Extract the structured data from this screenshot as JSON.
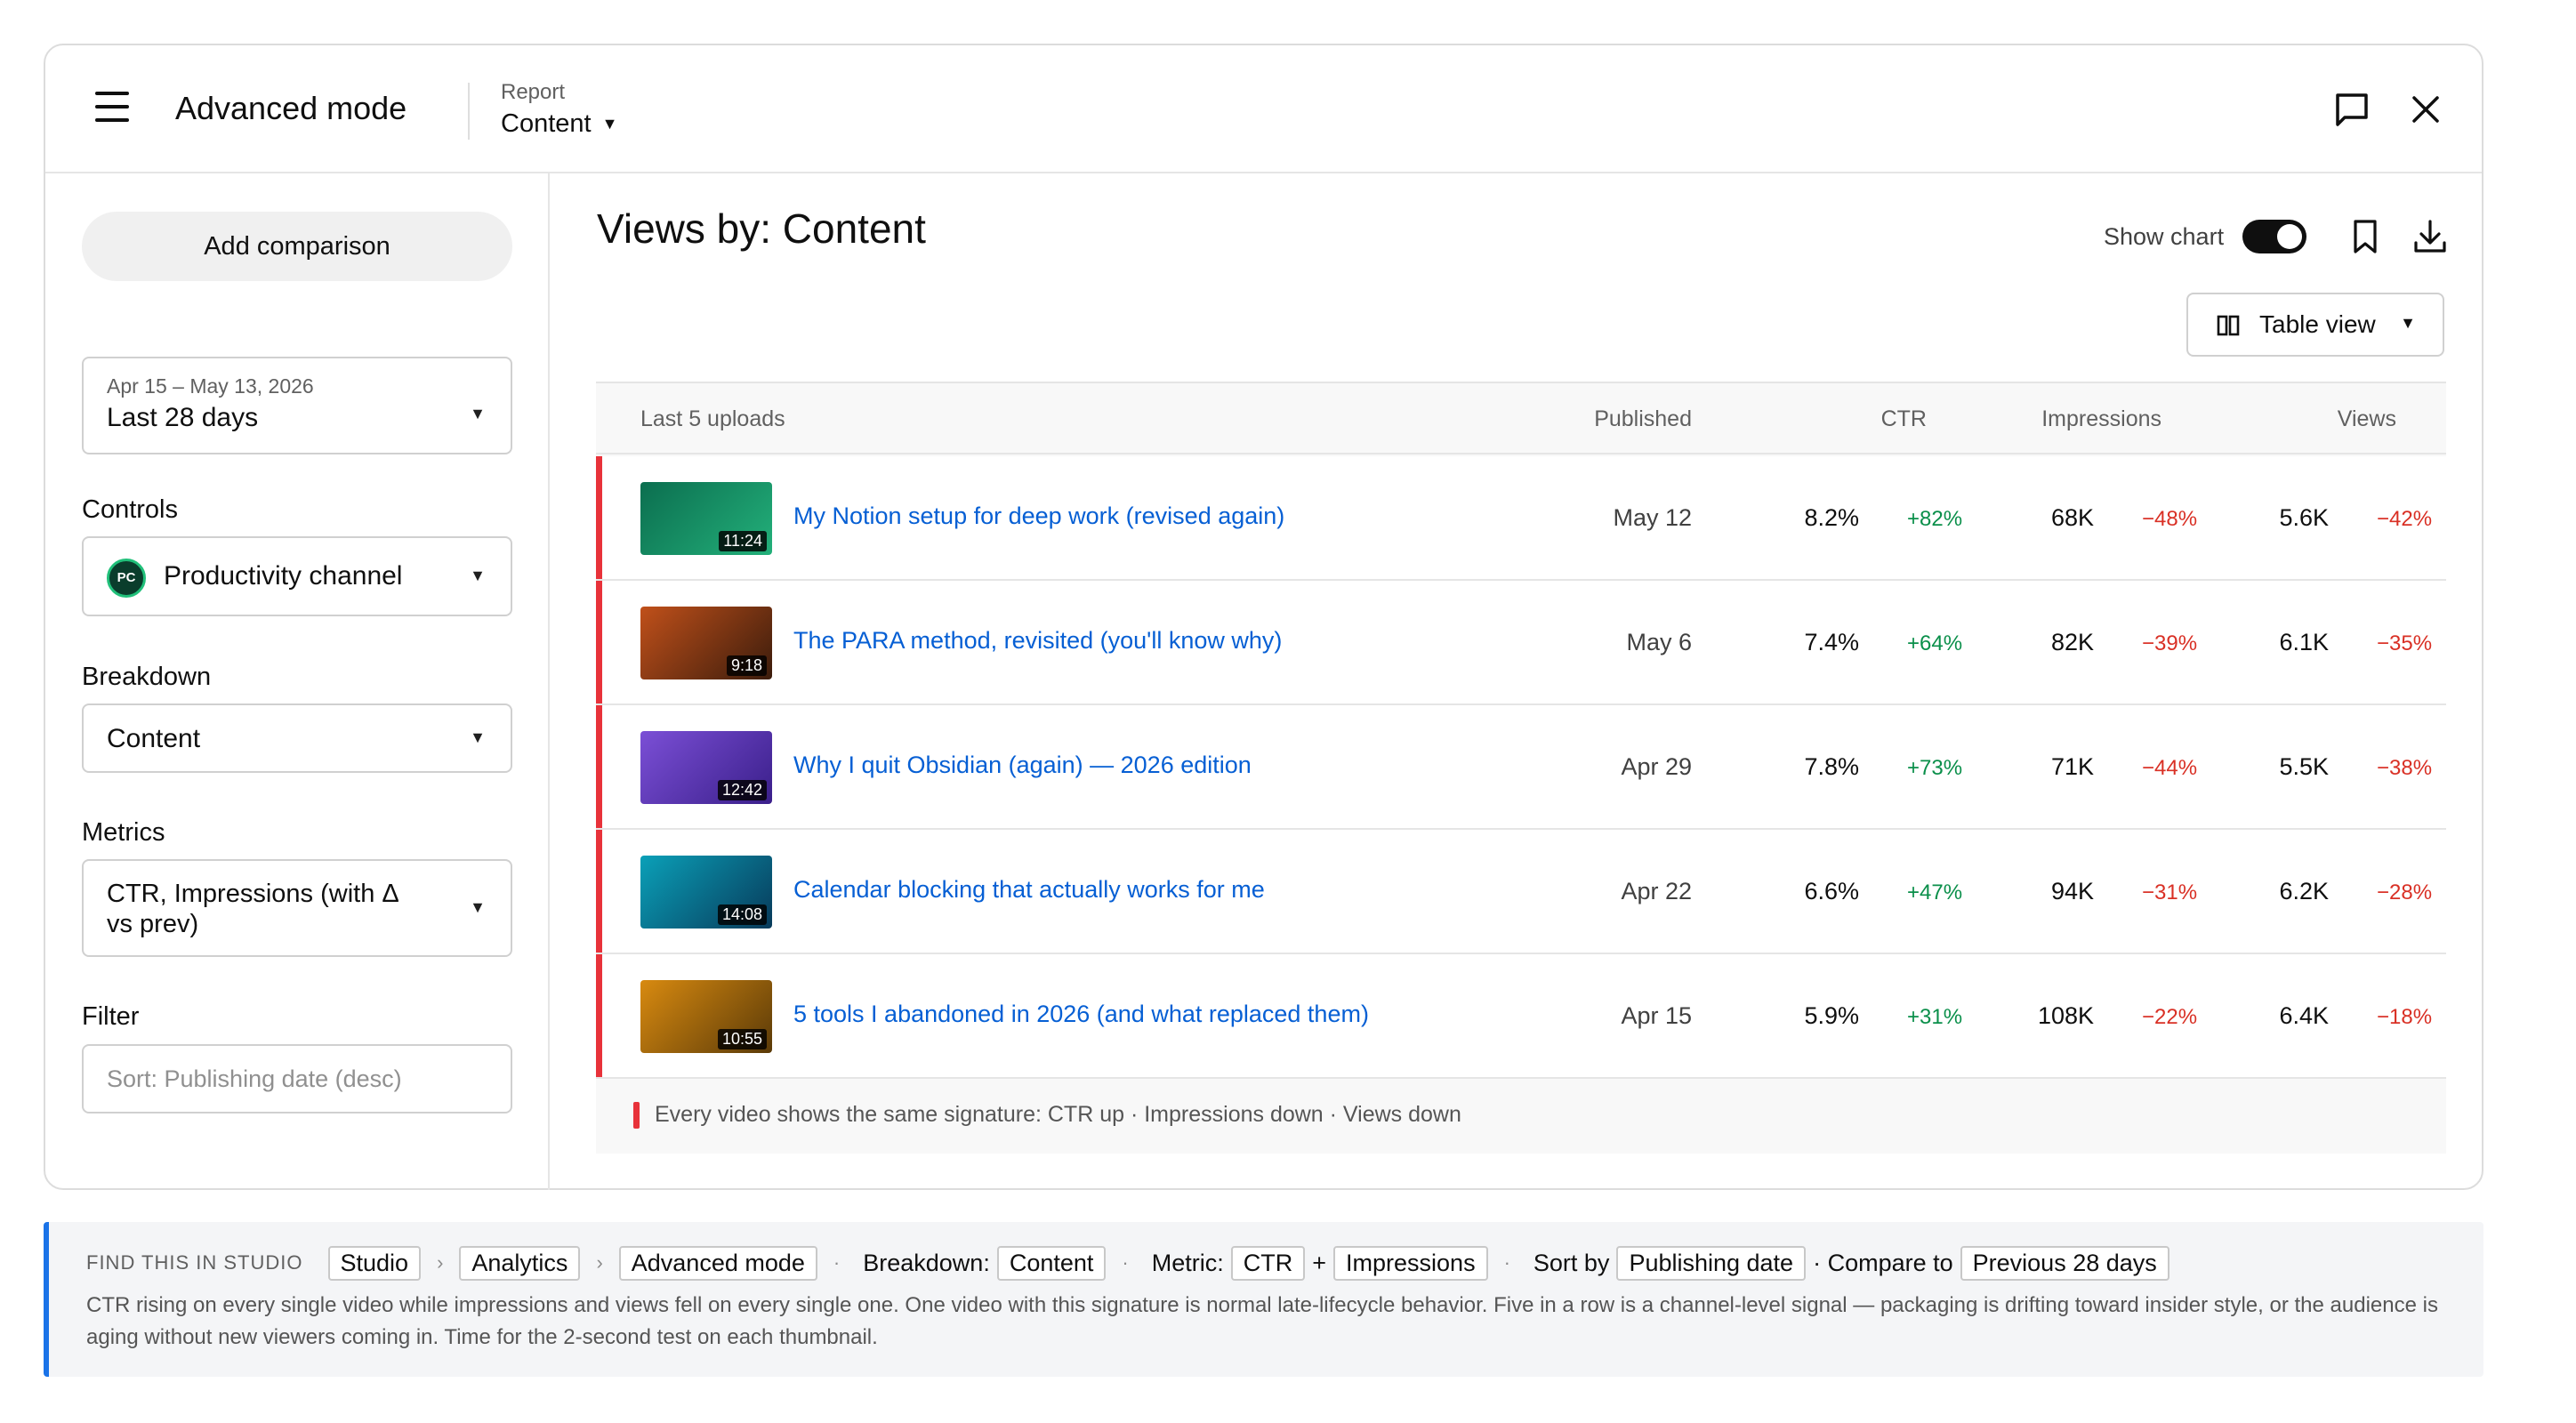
{
  "header": {
    "mode_title": "Advanced mode",
    "report_label": "Report",
    "report_value": "Content"
  },
  "sidebar": {
    "add_comparison": "Add comparison",
    "date_range": {
      "sub": "Apr 15 – May 13, 2026",
      "value": "Last 28 days"
    },
    "controls_label": "Controls",
    "channel": {
      "avatar": "PC",
      "name": "Productivity channel"
    },
    "breakdown_label": "Breakdown",
    "breakdown_value": "Content",
    "metrics_label": "Metrics",
    "metrics_value": "CTR, Impressions (with Δ vs prev)",
    "filter_label": "Filter",
    "filter_placeholder": "Sort: Publishing date (desc)"
  },
  "main": {
    "title": "Views by: Content",
    "show_chart_label": "Show chart",
    "show_chart_on": true,
    "table_view_label": "Table view"
  },
  "table": {
    "headers": {
      "uploads": "Last 5 uploads",
      "published": "Published",
      "ctr": "CTR",
      "impressions": "Impressions",
      "views": "Views"
    },
    "rows": [
      {
        "title": "My Notion setup for deep work (revised again)",
        "duration": "11:24",
        "published": "May 12",
        "ctr": "8.2%",
        "ctr_delta": "+82%",
        "impressions": "68K",
        "impressions_delta": "−48%",
        "views": "5.6K",
        "views_delta": "−42%",
        "thumb_colors": [
          "#0b6e4f",
          "#23b07a"
        ]
      },
      {
        "title": "The PARA method, revisited (you'll know why)",
        "duration": "9:18",
        "published": "May 6",
        "ctr": "7.4%",
        "ctr_delta": "+64%",
        "impressions": "82K",
        "impressions_delta": "−39%",
        "views": "6.1K",
        "views_delta": "−35%",
        "thumb_colors": [
          "#c0501a",
          "#3b1c0c"
        ]
      },
      {
        "title": "Why I quit Obsidian (again) — 2026 edition",
        "duration": "12:42",
        "published": "Apr 29",
        "ctr": "7.8%",
        "ctr_delta": "+73%",
        "impressions": "71K",
        "impressions_delta": "−44%",
        "views": "5.5K",
        "views_delta": "−38%",
        "thumb_colors": [
          "#7b4fd6",
          "#3a1f8a"
        ]
      },
      {
        "title": "Calendar blocking that actually works for me",
        "duration": "14:08",
        "published": "Apr 22",
        "ctr": "6.6%",
        "ctr_delta": "+47%",
        "impressions": "94K",
        "impressions_delta": "−31%",
        "views": "6.2K",
        "views_delta": "−28%",
        "thumb_colors": [
          "#0aa0b8",
          "#083a5a"
        ]
      },
      {
        "title": "5 tools I abandoned in 2026 (and what replaced them)",
        "duration": "10:55",
        "published": "Apr 15",
        "ctr": "5.9%",
        "ctr_delta": "+31%",
        "impressions": "108K",
        "impressions_delta": "−22%",
        "views": "6.4K",
        "views_delta": "−18%",
        "thumb_colors": [
          "#d88a10",
          "#5a3a08"
        ]
      }
    ],
    "footnote": "Every video shows the same signature: CTR up · Impressions down · Views down"
  },
  "studio": {
    "find_label": "FIND THIS IN STUDIO",
    "chip_studio": "Studio",
    "chip_analytics": "Analytics",
    "chip_advanced": "Advanced mode",
    "breakdown_text": "Breakdown:",
    "chip_content": "Content",
    "metric_text": "Metric:",
    "chip_ctr": "CTR",
    "plus": "+",
    "chip_impressions": "Impressions",
    "sort_text": "Sort by",
    "chip_publishing_date": "Publishing date",
    "compare_text": "· Compare to",
    "chip_previous": "Previous 28 days",
    "description": "CTR rising on every single video while impressions and views fell on every single one. One video with this signature is normal late-lifecycle behavior. Five in a row is a channel-level signal — packaging is drifting toward insider style, or the audience is aging without new viewers coming in. Time for the 2-second test on each thumbnail."
  },
  "colors": {
    "accent_blue": "#1a73e8",
    "link": "#065fd4",
    "flag_red": "#e8323a",
    "delta_up": "#0a8f4a",
    "delta_down": "#d93025"
  },
  "icons": {
    "menu": "hamburger-icon",
    "feedback": "feedback-icon",
    "close": "close-icon",
    "bookmark": "bookmark-icon",
    "download": "download-icon",
    "table": "columns-icon"
  }
}
